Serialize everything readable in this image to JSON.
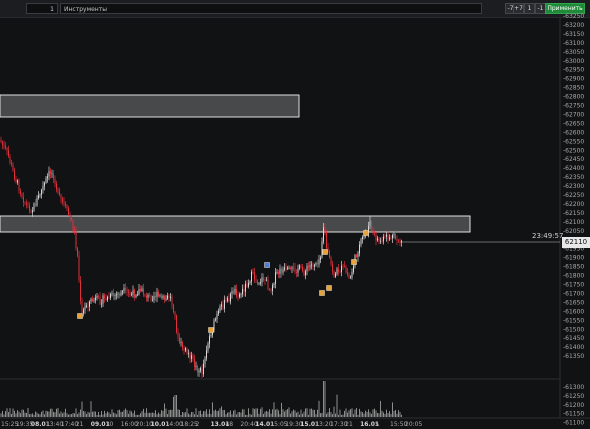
{
  "toolbar": {
    "count_value": "1",
    "instrument_label": "Инструменты",
    "buttons": [
      "-7",
      "+7",
      "1",
      "-1",
      "+1"
    ],
    "apply_label": "Применить"
  },
  "price_axis": {
    "labels": [
      "-63250",
      "-63200",
      "-63150",
      "-63100",
      "-63050",
      "-63000",
      "-62950",
      "-62900",
      "-62850",
      "-62800",
      "-62750",
      "-62700",
      "-62650",
      "-62600",
      "-62550",
      "-62500",
      "-62450",
      "-62400",
      "-62350",
      "-62300",
      "-62250",
      "-62200",
      "-62150",
      "-62100",
      "-62050",
      "-62000",
      "-61950",
      "-61900",
      "-61850",
      "-61800",
      "-61750",
      "-61700",
      "-61650",
      "-61600",
      "-61550",
      "-61500",
      "-61450",
      "-61400",
      "-61350"
    ],
    "current_price": "62110",
    "clock": "23:49:57"
  },
  "volume_axis": {
    "labels": [
      "-61300",
      "-61250",
      "-61200",
      "-61150",
      "-61100"
    ]
  },
  "time_axis": {
    "labels": [
      {
        "text": "15:25",
        "bold": false
      },
      {
        "text": "19:35",
        "bold": false
      },
      {
        "text": "08.01",
        "bold": true
      },
      {
        "text": "13:40",
        "bold": false
      },
      {
        "text": "17:40",
        "bold": false
      },
      {
        "text": "21",
        "bold": false
      },
      {
        "text": "09.01",
        "bold": true
      },
      {
        "text": "30",
        "bold": false
      },
      {
        "text": "16:00",
        "bold": false
      },
      {
        "text": "20:10",
        "bold": false
      },
      {
        "text": "10.01",
        "bold": true
      },
      {
        "text": "14:00",
        "bold": false
      },
      {
        "text": "18:25",
        "bold": false
      },
      {
        "text": "2",
        "bold": false
      },
      {
        "text": "13.01",
        "bold": true
      },
      {
        "text": "48",
        "bold": false
      },
      {
        "text": "20:40",
        "bold": false
      },
      {
        "text": "14.01",
        "bold": true
      },
      {
        "text": "15:05",
        "bold": false
      },
      {
        "text": "19:30",
        "bold": false
      },
      {
        "text": "15.01",
        "bold": true
      },
      {
        "text": "13:20",
        "bold": false
      },
      {
        "text": "17:30",
        "bold": false
      },
      {
        "text": "21",
        "bold": false
      },
      {
        "text": "16.01",
        "bold": true
      },
      {
        "text": "5",
        "bold": false
      },
      {
        "text": "15:50",
        "bold": false
      },
      {
        "text": "20:05",
        "bold": false
      }
    ]
  },
  "colors": {
    "background": "#111214",
    "candle_up": "#d9d9d9",
    "candle_down": "#e0303a",
    "zone_fill": "#d8d8d8",
    "marker_orange": "#e8a23a",
    "marker_blue": "#4d7ed8",
    "apply_button": "#1f8a3a"
  }
}
